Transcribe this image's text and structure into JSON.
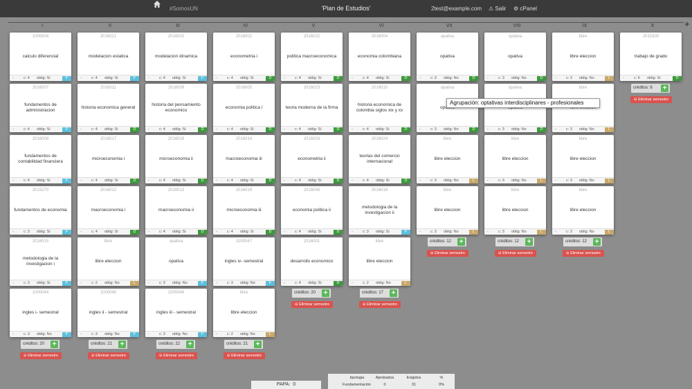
{
  "topbar": {
    "tag": "#SomosUN",
    "title": "'Plan de Estudios'",
    "email": "2test@example.com",
    "salir": "Salir",
    "cpanel": "cPanel",
    "add_semester": "+"
  },
  "columns": [
    "I",
    "II",
    "III",
    "IV",
    "V",
    "VI",
    "VII",
    "VIII",
    "IX",
    "X"
  ],
  "semesters": [
    {
      "courses": [
        {
          "code": "1000004",
          "name": "calculo diferencial",
          "credits": "c: 4",
          "oblig": "oblig: Si",
          "tag": "F"
        },
        {
          "code": "2016007",
          "name": "fundamentos de administracion",
          "credits": "c: 4",
          "oblig": "oblig: Si",
          "tag": "F"
        },
        {
          "code": "2016008",
          "name": "fundamentos de contabilidad financiera",
          "credits": "c: 4",
          "oblig": "oblig: Si",
          "tag": "F"
        },
        {
          "code": "2015270",
          "name": "fundamentos de economia",
          "credits": "c: 3",
          "oblig": "oblig: Si",
          "tag": "F"
        },
        {
          "code": "2016015",
          "name": "metodologia de la investigacion i",
          "credits": "c: 3",
          "oblig": "oblig: Si",
          "tag": "F"
        },
        {
          "code": "1000044",
          "name": "ingles i- semestral",
          "credits": "c: 3",
          "oblig": "oblig: No",
          "tag": "F"
        }
      ],
      "total": "créditos: 20",
      "delete": "Eliminar semestre"
    },
    {
      "courses": [
        {
          "code": "2016021",
          "name": "modelacion estatica",
          "credits": "c: 4",
          "oblig": "oblig: Si",
          "tag": "F"
        },
        {
          "code": "2016011",
          "name": "historia economica general",
          "credits": "c: 4",
          "oblig": "oblig: Si",
          "tag": "D"
        },
        {
          "code": "2016017",
          "name": "microeconomia i",
          "credits": "c: 4",
          "oblig": "oblig: Si",
          "tag": "D"
        },
        {
          "code": "2016012",
          "name": "macroeconomia i",
          "credits": "c: 4",
          "oblig": "oblig: Si",
          "tag": "D"
        },
        {
          "code": "libre",
          "name": "libre eleccion",
          "credits": "c: 2",
          "oblig": "oblig: No",
          "tag": "L"
        },
        {
          "code": "1000045",
          "name": "ingles ii - semestral",
          "credits": "c: 3",
          "oblig": "oblig: No",
          "tag": "F"
        }
      ],
      "total": "créditos: 21",
      "delete": "Eliminar semestre"
    },
    {
      "courses": [
        {
          "code": "2016020",
          "name": "modelacion dinamica",
          "credits": "c: 4",
          "oblig": "oblig: Si",
          "tag": "F"
        },
        {
          "code": "2016009",
          "name": "historia del pensamiento economico",
          "credits": "c: 4",
          "oblig": "oblig: Si",
          "tag": "D"
        },
        {
          "code": "2016018",
          "name": "microeconomia ii",
          "credits": "c: 4",
          "oblig": "oblig: Si",
          "tag": "D"
        },
        {
          "code": "2016013",
          "name": "macroeconomia  ii",
          "credits": "c: 4",
          "oblig": "oblig: Si",
          "tag": "D"
        },
        {
          "code": "opativa",
          "name": "opativa",
          "credits": "c: 3",
          "oblig": "oblig: No",
          "tag": "F"
        },
        {
          "code": "1000046",
          "name": "ingles iii - semestral",
          "credits": "c: 3",
          "oblig": "oblig: No",
          "tag": "F"
        }
      ],
      "total": "créditos: 22",
      "delete": "Eliminar semestre"
    },
    {
      "courses": [
        {
          "code": "2016002",
          "name": "econometria i",
          "credits": "c: 4",
          "oblig": "oblig: Si",
          "tag": "D"
        },
        {
          "code": "2016005",
          "name": "economia politica i",
          "credits": "c: 4",
          "oblig": "oblig: Si",
          "tag": "D"
        },
        {
          "code": "2016014",
          "name": "macroeconomia iii",
          "credits": "c: 4",
          "oblig": "oblig: Si",
          "tag": "D"
        },
        {
          "code": "2016019",
          "name": "microeconomia  iii",
          "credits": "c: 4",
          "oblig": "oblig: Si",
          "tag": "D"
        },
        {
          "code": "1000047",
          "name": "ingles iv- semestral",
          "credits": "c: 3",
          "oblig": "oblig: No",
          "tag": "F"
        },
        {
          "code": "libre",
          "name": "libre eleccion",
          "credits": "c: 2",
          "oblig": "oblig: No",
          "tag": "L"
        }
      ],
      "total": "créditos: 21",
      "delete": "Eliminar semestre"
    },
    {
      "courses": [
        {
          "code": "2016022",
          "name": "politica macroeconomica",
          "credits": "c: 4",
          "oblig": "oblig: Si",
          "tag": "D"
        },
        {
          "code": "2016023",
          "name": "teoria moderna de la firma",
          "credits": "c: 4",
          "oblig": "oblig: Si",
          "tag": "D"
        },
        {
          "code": "2016003",
          "name": "econometria ii",
          "credits": "c: 4",
          "oblig": "oblig: Si",
          "tag": "D"
        },
        {
          "code": "2016006",
          "name": "economia politica ii",
          "credits": "c: 4",
          "oblig": "oblig: Si",
          "tag": "D"
        },
        {
          "code": "2016001",
          "name": "desarrollo economico",
          "credits": "c: 4",
          "oblig": "oblig: Si",
          "tag": "D"
        }
      ],
      "total": "créditos: 20",
      "delete": "Eliminar semestre"
    },
    {
      "courses": [
        {
          "code": "2016004",
          "name": "economia colombiana",
          "credits": "c: 4",
          "oblig": "oblig: Si",
          "tag": "D"
        },
        {
          "code": "2016010",
          "name": "historia economica de colombia siglos xix y xx",
          "credits": "c: 4",
          "oblig": "oblig: Si",
          "tag": "D"
        },
        {
          "code": "2016024",
          "name": "teorias del comercio internacional",
          "credits": "c: 4",
          "oblig": "oblig: Si",
          "tag": "D"
        },
        {
          "code": "2016016",
          "name": "metodologia de la investigacion ii",
          "credits": "c: 3",
          "oblig": "oblig: Si",
          "tag": "F"
        },
        {
          "code": "libre",
          "name": "libre eleccion",
          "credits": "c: 2",
          "oblig": "oblig: No",
          "tag": "L"
        }
      ],
      "total": "créditos: 17",
      "delete": "Eliminar semestre"
    },
    {
      "courses": [
        {
          "code": "opativa",
          "name": "opativa",
          "credits": "c: 3",
          "oblig": "oblig: No",
          "tag": "D"
        },
        {
          "code": "opativa",
          "name": "opativa",
          "credits": "c: 3",
          "oblig": "oblig: No",
          "tag": "D"
        },
        {
          "code": "libre",
          "name": "libre eleccion",
          "credits": "c: 3",
          "oblig": "oblig: No",
          "tag": "L"
        },
        {
          "code": "libre",
          "name": "libre eleccion",
          "credits": "c: 3",
          "oblig": "oblig: No",
          "tag": "L"
        }
      ],
      "total": "créditos: 12",
      "delete": "Eliminar semestre"
    },
    {
      "courses": [
        {
          "code": "opativa",
          "name": "opativa",
          "credits": "c: 3",
          "oblig": "oblig: No",
          "tag": "D"
        },
        {
          "code": "opativa",
          "name": "opativa",
          "credits": "c: 3",
          "oblig": "oblig: No",
          "tag": "D"
        },
        {
          "code": "libre",
          "name": "libre eleccion",
          "credits": "c: 3",
          "oblig": "oblig: No",
          "tag": "L"
        },
        {
          "code": "libre",
          "name": "libre eleccion",
          "credits": "c: 3",
          "oblig": "oblig: No",
          "tag": "L"
        }
      ],
      "total": "créditos: 12",
      "delete": "Eliminar semestre"
    },
    {
      "courses": [
        {
          "code": "libre",
          "name": "libre eleccion",
          "credits": "c: 3",
          "oblig": "oblig: No",
          "tag": "L"
        },
        {
          "code": "libre",
          "name": "libre eleccion",
          "credits": "c: 3",
          "oblig": "oblig: No",
          "tag": "L"
        },
        {
          "code": "libre",
          "name": "libre eleccion",
          "credits": "c: 3",
          "oblig": "oblig: No",
          "tag": "L"
        },
        {
          "code": "libre",
          "name": "libre eleccion",
          "credits": "c: 3",
          "oblig": "oblig: No",
          "tag": "L"
        }
      ],
      "total": "créditos: 12",
      "delete": "Eliminar semestre"
    },
    {
      "courses": [
        {
          "code": "2015300",
          "name": "trabajo de grado",
          "credits": "c: 6",
          "oblig": "oblig: Si",
          "tag": "D"
        }
      ],
      "total": "créditos: 6",
      "delete": "Eliminar semestre"
    }
  ],
  "tooltip": "Agrupación: optativas interdisciplinares - profesionales",
  "papa": {
    "label": "PAPA:",
    "value": "0"
  },
  "stats": {
    "headers": [
      "tipologia",
      "Aprobados",
      "Exigidos",
      "%"
    ],
    "row": [
      "Fundamentación",
      "0",
      "31",
      "0%"
    ]
  },
  "colors": {
    "F": "#5bc0de",
    "D": "#3c9a3c",
    "L": "#c9a86a",
    "plus": "#5cb85c",
    "delete": "#d9534f"
  }
}
